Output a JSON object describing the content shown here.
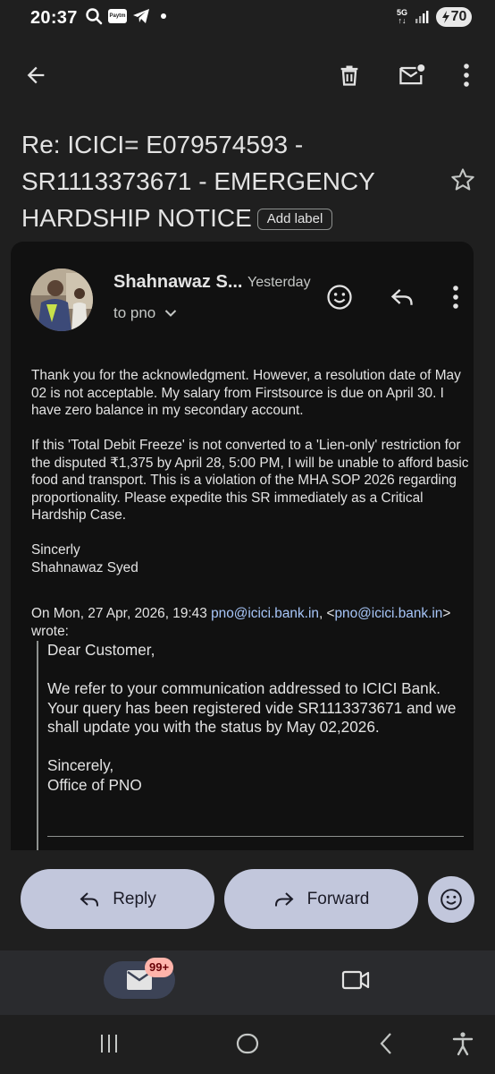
{
  "status_bar": {
    "time": "20:37",
    "paytm": "Paytm",
    "network": "5G",
    "battery": "70"
  },
  "subject": {
    "text": "Re: ICICI= E079574593 -SR1113373671 - EMERGENCY HARDSHIP NOTICE",
    "add_label": "Add label"
  },
  "message": {
    "sender": "Shahnawaz S...",
    "time": "Yesterday",
    "to": "to pno",
    "body": [
      "Thank you for the acknowledgment. However, a resolution date of May 02 is not acceptable. My salary from Firstsource is due on April 30. I have zero balance in my secondary account.",
      "If this 'Total Debit Freeze' is not converted to a 'Lien-only' restriction for the disputed ₹1,375 by April 28, 5:00 PM, I will be unable to afford basic food and transport. This is a violation of the MHA SOP 2026 regarding proportionality. Please expedite this SR immediately as a Critical Hardship Case.",
      "Sincerly",
      "Shahnawaz Syed"
    ],
    "quote_intro_prefix": "On Mon, 27 Apr, 2026, 19:43 ",
    "quote_email": "pno@icici.bank.in",
    "quote_intro_mid": ", <",
    "quote_email2": "pno@icici.bank.in",
    "quote_intro_suffix": "> wrote:",
    "quoted": [
      "Dear Customer,",
      "We refer to your communication addressed to ICICI Bank. Your query has been registered vide SR1113373671 and we shall update you with the status by May 02,2026.",
      "Sincerely,",
      "Office of PNO"
    ]
  },
  "actions": {
    "reply": "Reply",
    "forward": "Forward"
  },
  "bottom_nav": {
    "mail_badge": "99+"
  },
  "colors": {
    "background": "#1f1f1f",
    "card": "#111111",
    "pill": "#c2c7dc",
    "link": "#a8c7fa",
    "badge": "#ffb4ab"
  }
}
